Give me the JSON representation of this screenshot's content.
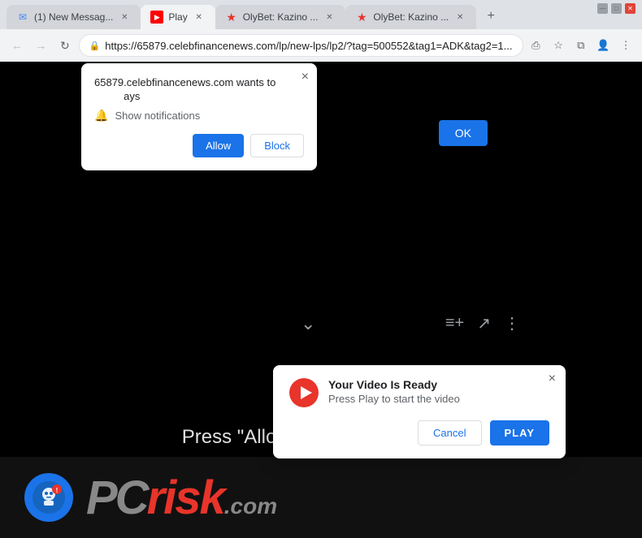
{
  "browser": {
    "tabs": [
      {
        "id": "tab1",
        "label": "(1) New Messag...",
        "favicon": "mail",
        "active": false
      },
      {
        "id": "tab2",
        "label": "Play",
        "favicon": "play",
        "active": true
      },
      {
        "id": "tab3",
        "label": "OlyBet: Kazino ...",
        "favicon": "star",
        "active": false
      },
      {
        "id": "tab4",
        "label": "OlyBet: Kazino ...",
        "favicon": "star",
        "active": false
      }
    ],
    "new_tab_label": "+",
    "address": "https://65879.celebfinancenews.com/lp/new-lps/lp2/?tag=500552&tag1=ADK&tag2=1...",
    "window_controls": [
      "—",
      "□",
      "✕"
    ]
  },
  "nav": {
    "back": "←",
    "forward": "→",
    "reload": "↻"
  },
  "notif_dialog": {
    "site": "65879.celebfinancenews.com wants to",
    "suffix": "ays",
    "bell_label": "Show notifications",
    "allow_btn": "Allow",
    "block_btn": "Block",
    "close": "×"
  },
  "ok_button": "OK",
  "arrow": "⌄",
  "video_popup": {
    "title": "Your Video Is Ready",
    "subtitle": "Press Play to start the video",
    "cancel_btn": "Cancel",
    "play_btn": "PLAY",
    "close": "×"
  },
  "bottom_text": "Press \"Allow\" to watch the video",
  "pcrisk": {
    "text_gray": "PC",
    "text_red": "risk",
    "suffix": ".com"
  },
  "addr_icons": {
    "lock": "🔒",
    "bookmark": "☆",
    "extensions": "⧉",
    "account": "👤",
    "menu": "⋮",
    "share": "⎙"
  }
}
